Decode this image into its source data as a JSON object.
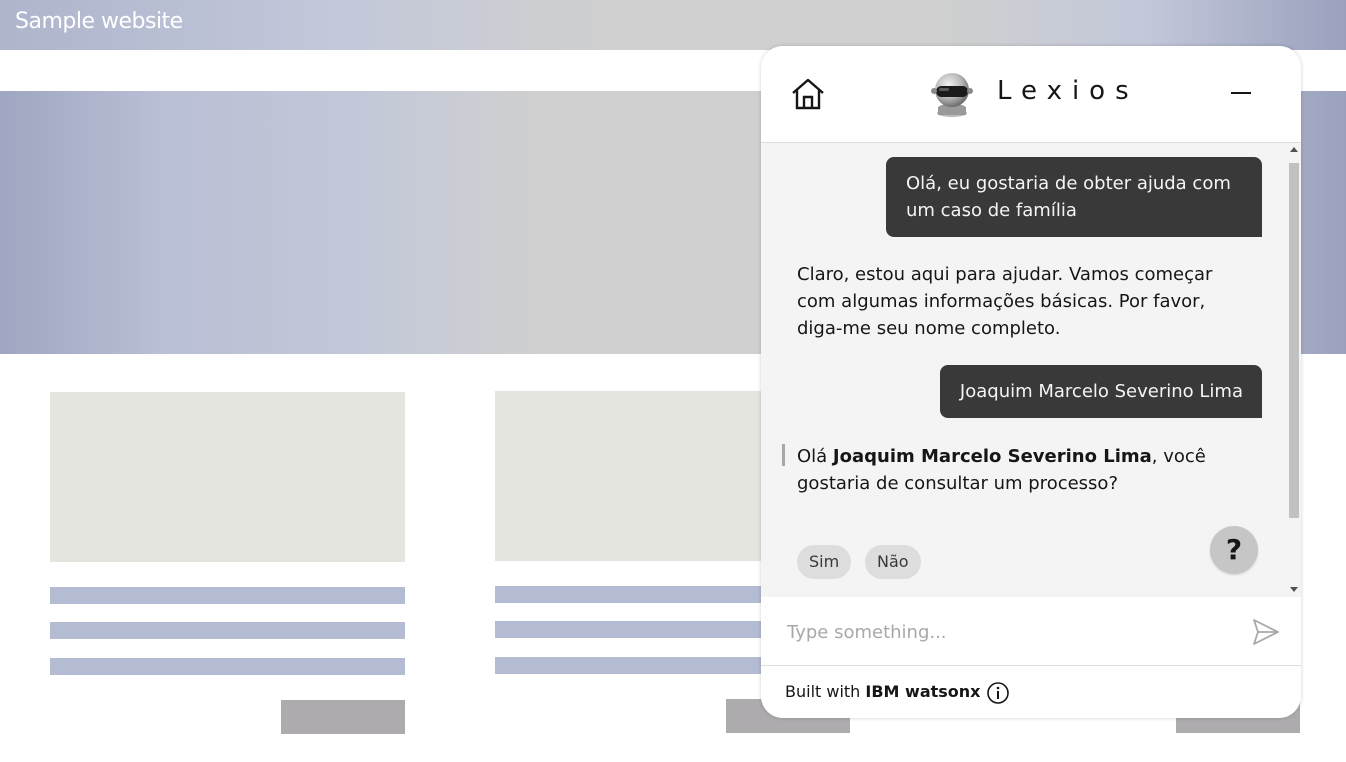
{
  "site": {
    "title": "Sample website"
  },
  "chat": {
    "bot_name": "Lexios",
    "icons": {
      "home": "home-icon",
      "avatar": "robot-avatar",
      "minimize": "minimize-icon",
      "send": "send-icon",
      "info": "info-icon",
      "help": "help-icon"
    },
    "messages": [
      {
        "role": "user",
        "text": "Olá, eu gostaria de obter ajuda com um caso de família"
      },
      {
        "role": "bot",
        "text": "Claro, estou aqui para ajudar. Vamos começar com algumas informações básicas. Por favor, diga-me seu nome completo."
      },
      {
        "role": "user",
        "text": "Joaquim Marcelo Severino Lima"
      },
      {
        "role": "bot",
        "prefix": "Olá ",
        "name": "Joaquim Marcelo Severino Lima",
        "suffix": ", você gostaria de consultar um processo?"
      }
    ],
    "quick_replies": [
      "Sim",
      "Não"
    ],
    "help_label": "?",
    "input": {
      "placeholder": "Type something..."
    },
    "footer": {
      "prefix": "Built with ",
      "brand": "IBM watsonx"
    }
  },
  "colors": {
    "user_bubble": "#393939",
    "message_area": "#f4f4f4",
    "chip": "#dddddd"
  }
}
